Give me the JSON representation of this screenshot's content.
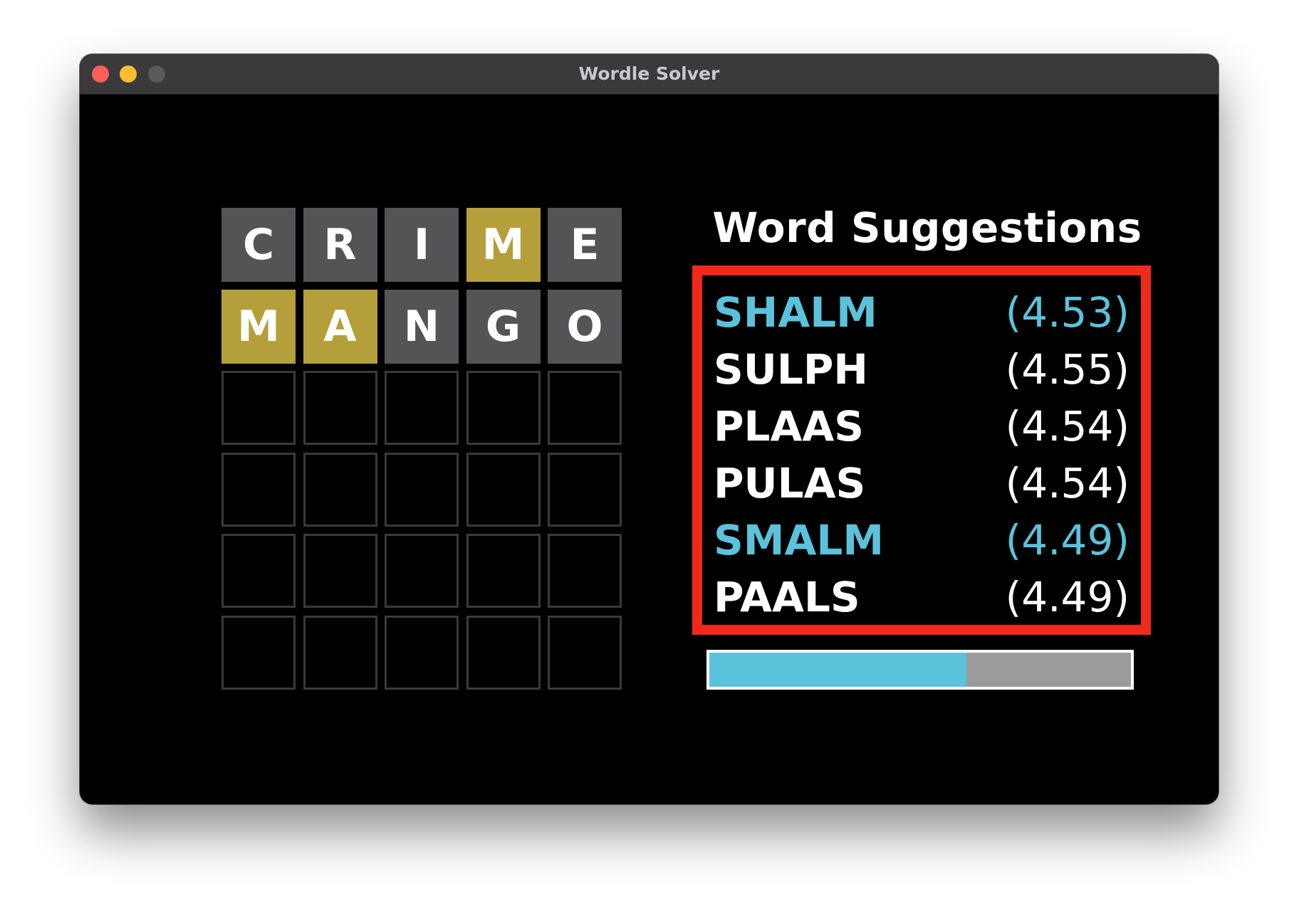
{
  "window": {
    "title": "Wordle Solver"
  },
  "colors": {
    "tile_absent": "#545456",
    "tile_present": "#b59f3b",
    "tile_empty_border": "#3a3a3c",
    "highlight_text": "#5bc2db",
    "normal_text": "#ffffff",
    "suggestion_border": "#f0281d",
    "progress_fill": "#5bc2db",
    "progress_track": "#9b9b9b"
  },
  "board": {
    "rows": [
      {
        "tiles": [
          {
            "letter": "C",
            "state": "absent"
          },
          {
            "letter": "R",
            "state": "absent"
          },
          {
            "letter": "I",
            "state": "absent"
          },
          {
            "letter": "M",
            "state": "present"
          },
          {
            "letter": "E",
            "state": "absent"
          }
        ]
      },
      {
        "tiles": [
          {
            "letter": "M",
            "state": "present"
          },
          {
            "letter": "A",
            "state": "present"
          },
          {
            "letter": "N",
            "state": "absent"
          },
          {
            "letter": "G",
            "state": "absent"
          },
          {
            "letter": "O",
            "state": "absent"
          }
        ]
      },
      {
        "tiles": [
          {
            "letter": "",
            "state": "empty"
          },
          {
            "letter": "",
            "state": "empty"
          },
          {
            "letter": "",
            "state": "empty"
          },
          {
            "letter": "",
            "state": "empty"
          },
          {
            "letter": "",
            "state": "empty"
          }
        ]
      },
      {
        "tiles": [
          {
            "letter": "",
            "state": "empty"
          },
          {
            "letter": "",
            "state": "empty"
          },
          {
            "letter": "",
            "state": "empty"
          },
          {
            "letter": "",
            "state": "empty"
          },
          {
            "letter": "",
            "state": "empty"
          }
        ]
      },
      {
        "tiles": [
          {
            "letter": "",
            "state": "empty"
          },
          {
            "letter": "",
            "state": "empty"
          },
          {
            "letter": "",
            "state": "empty"
          },
          {
            "letter": "",
            "state": "empty"
          },
          {
            "letter": "",
            "state": "empty"
          }
        ]
      },
      {
        "tiles": [
          {
            "letter": "",
            "state": "empty"
          },
          {
            "letter": "",
            "state": "empty"
          },
          {
            "letter": "",
            "state": "empty"
          },
          {
            "letter": "",
            "state": "empty"
          },
          {
            "letter": "",
            "state": "empty"
          }
        ]
      }
    ]
  },
  "suggestions": {
    "title": "Word Suggestions",
    "items": [
      {
        "word": "SHALM",
        "score": "(4.53)",
        "highlighted": true
      },
      {
        "word": "SULPH",
        "score": "(4.55)",
        "highlighted": false
      },
      {
        "word": "PLAAS",
        "score": "(4.54)",
        "highlighted": false
      },
      {
        "word": "PULAS",
        "score": "(4.54)",
        "highlighted": false
      },
      {
        "word": "SMALM",
        "score": "(4.49)",
        "highlighted": true
      },
      {
        "word": "PAALS",
        "score": "(4.49)",
        "highlighted": false
      }
    ]
  },
  "progress": {
    "value": 0.61
  }
}
